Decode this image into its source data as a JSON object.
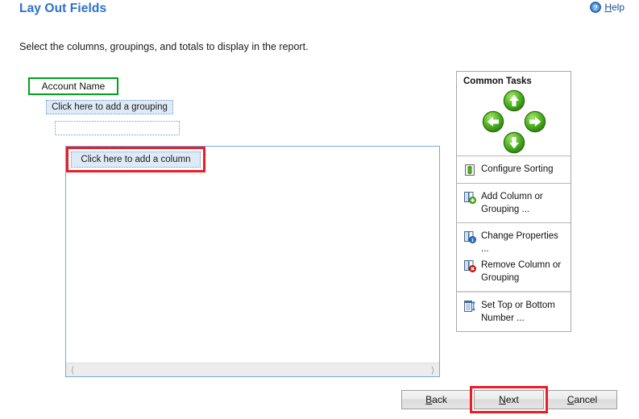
{
  "header": {
    "title": "Lay Out Fields",
    "help_label": "Help",
    "help_accel": "H",
    "help_rest": "elp",
    "help_icon": "question-mark-circle-icon"
  },
  "subtitle": "Select the columns, groupings, and totals to display in the report.",
  "designer": {
    "account_name_field": "Account Name",
    "grouping_placeholder": "Click here to add a grouping",
    "empty_row": "",
    "column_placeholder": "Click here to add a column",
    "scroll_left_icon": "chevron-left-icon",
    "scroll_right_icon": "chevron-right-icon",
    "highlight_colors": {
      "account_name": "#00a21a",
      "column": "#ee1c25"
    }
  },
  "common_tasks": {
    "header": "Common Tasks",
    "dpad": [
      {
        "name": "move-up-button",
        "icon": "arrow-up-icon"
      },
      {
        "name": "move-left-button",
        "icon": "arrow-left-icon"
      },
      {
        "name": "move-right-button",
        "icon": "arrow-right-icon"
      },
      {
        "name": "move-down-button",
        "icon": "arrow-down-icon"
      }
    ],
    "groups": [
      {
        "items": [
          {
            "label": "Configure Sorting",
            "icon": "sort-icon"
          }
        ]
      },
      {
        "items": [
          {
            "label": "Add Column or Grouping ...",
            "icon": "add-column-icon"
          }
        ]
      },
      {
        "items": [
          {
            "label": "Change Properties ...",
            "icon": "properties-icon"
          },
          {
            "label": "Remove Column or Grouping",
            "icon": "remove-column-icon"
          }
        ]
      },
      {
        "items": [
          {
            "label": "Set Top or Bottom Number ...",
            "icon": "top-bottom-icon"
          }
        ]
      }
    ]
  },
  "footer": {
    "back": {
      "accel": "B",
      "rest": "ack"
    },
    "next": {
      "accel": "N",
      "rest": "ext"
    },
    "cancel": {
      "accel": "C",
      "rest": "ancel"
    },
    "highlight_color": "#ee1c25"
  }
}
